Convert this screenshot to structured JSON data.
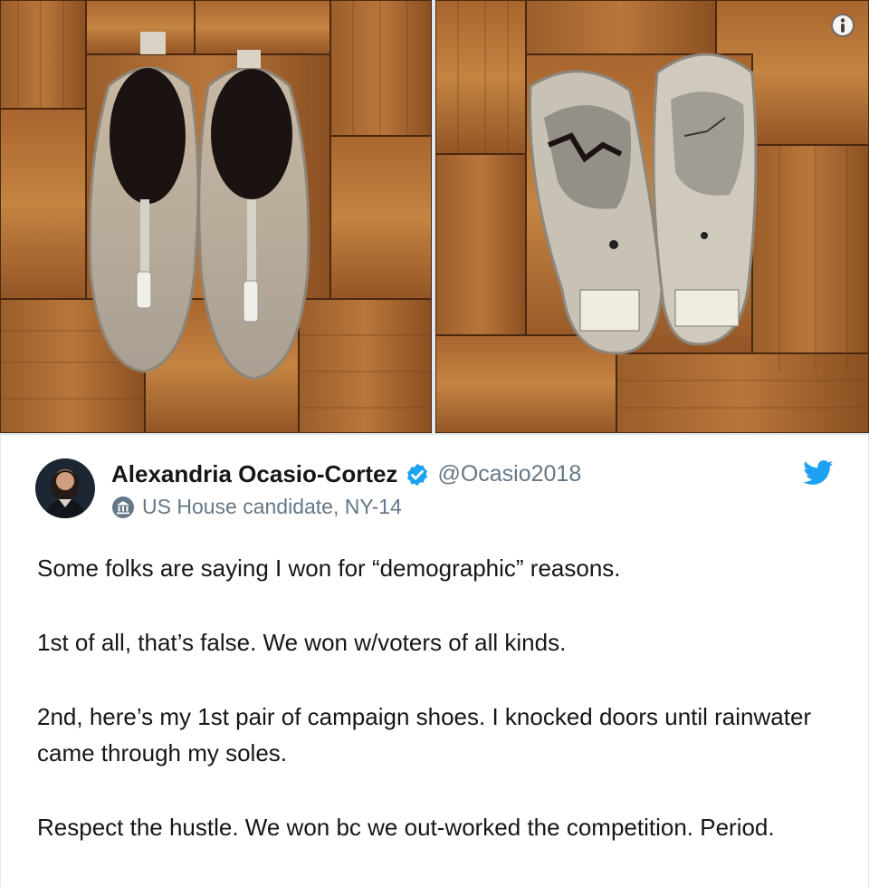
{
  "media": {
    "images": [
      {
        "alt": "campaign shoes, top view",
        "icon": "shoes-top-photo"
      },
      {
        "alt": "campaign shoes, worn soles",
        "icon": "shoes-soles-photo"
      }
    ],
    "info_icon": "info-icon"
  },
  "tweet": {
    "author": {
      "display_name": "Alexandria Ocasio-Cortez",
      "handle": "@Ocasio2018",
      "verified": true,
      "label": "US House candidate, NY-14"
    },
    "paragraphs": [
      "Some folks are saying I won for “demographic” reasons.",
      "1st of all, that’s false. We won w/voters of all kinds.",
      "2nd, here’s my 1st pair of campaign shoes. I knocked doors until rainwater came through my soles.",
      "Respect the hustle. We won bc we out-worked the competition. Period."
    ]
  },
  "colors": {
    "twitter_blue": "#1da1f2",
    "text": "#14171a",
    "secondary_text": "#657786",
    "wood_dark": "#6b3f1c",
    "wood_light": "#b7753a"
  }
}
